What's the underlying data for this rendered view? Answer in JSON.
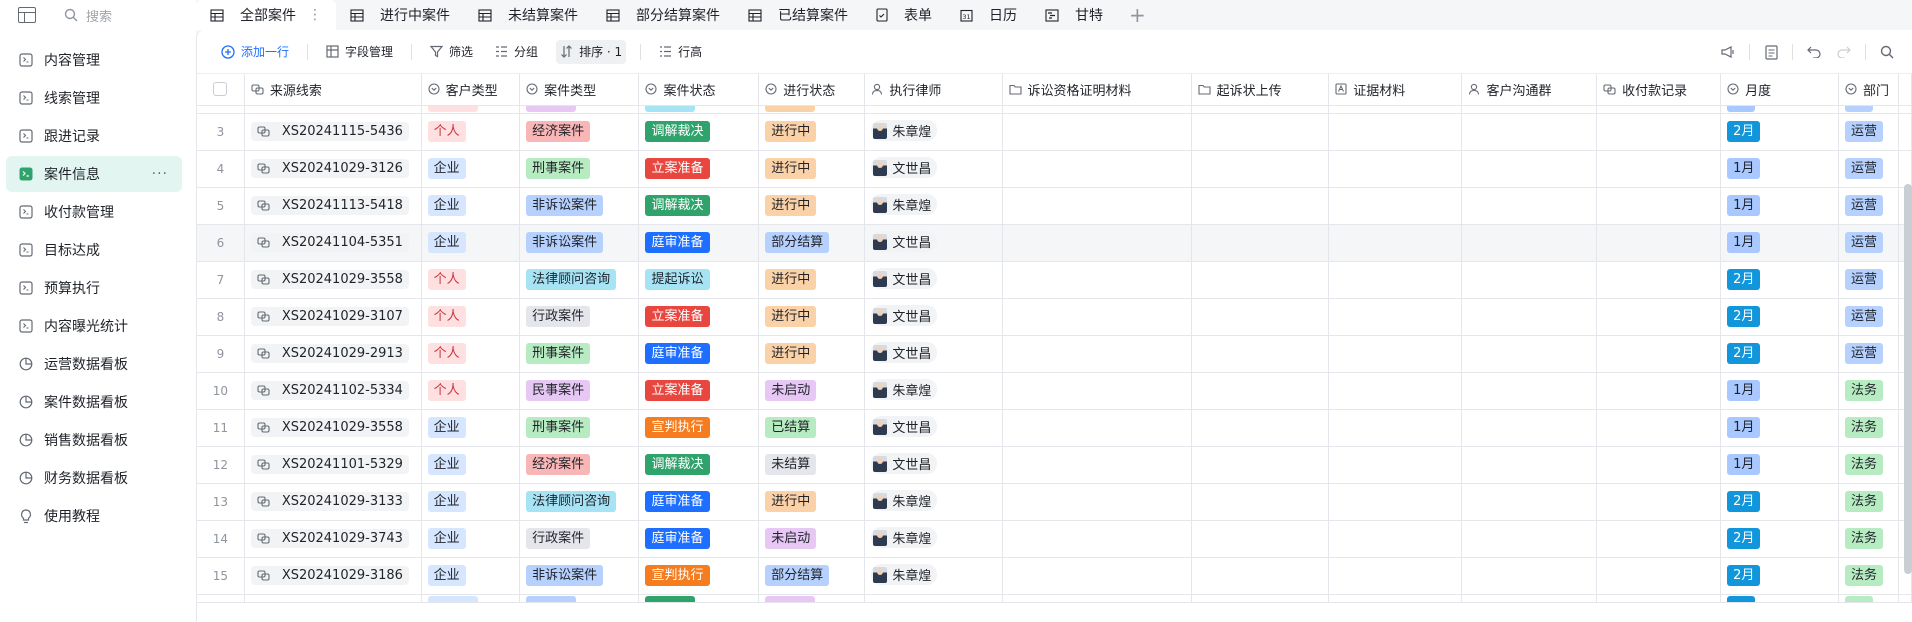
{
  "sidebar": {
    "search_placeholder": "搜索",
    "items": [
      {
        "label": "内容管理",
        "icon": "table-icon",
        "active": false
      },
      {
        "label": "线索管理",
        "icon": "table-icon",
        "active": false
      },
      {
        "label": "跟进记录",
        "icon": "table-icon",
        "active": false
      },
      {
        "label": "案件信息",
        "icon": "table-icon",
        "active": true,
        "more": "···"
      },
      {
        "label": "收付款管理",
        "icon": "table-icon",
        "active": false
      },
      {
        "label": "目标达成",
        "icon": "table-icon",
        "active": false
      },
      {
        "label": "预算执行",
        "icon": "table-icon",
        "active": false
      },
      {
        "label": "内容曝光统计",
        "icon": "table-icon",
        "active": false
      },
      {
        "label": "运营数据看板",
        "icon": "pie-chart-icon",
        "active": false
      },
      {
        "label": "案件数据看板",
        "icon": "pie-chart-icon",
        "active": false
      },
      {
        "label": "销售数据看板",
        "icon": "pie-chart-icon",
        "active": false
      },
      {
        "label": "财务数据看板",
        "icon": "pie-chart-icon",
        "active": false
      },
      {
        "label": "使用教程",
        "icon": "bulb-icon",
        "active": false
      }
    ]
  },
  "tabs": [
    {
      "label": "全部案件",
      "icon": "grid-icon",
      "active": true
    },
    {
      "label": "进行中案件",
      "icon": "grid-icon"
    },
    {
      "label": "未结算案件",
      "icon": "grid-icon"
    },
    {
      "label": "部分结算案件",
      "icon": "grid-icon"
    },
    {
      "label": "已结算案件",
      "icon": "grid-icon"
    },
    {
      "label": "表单",
      "icon": "form-icon"
    },
    {
      "label": "日历",
      "icon": "calendar-icon"
    },
    {
      "label": "甘特",
      "icon": "gantt-icon"
    }
  ],
  "tab_more": "⋮",
  "tab_add": "+",
  "toolbar": {
    "add_row": "添加一行",
    "fields": "字段管理",
    "filter": "筛选",
    "group": "分组",
    "sort": "排序 · 1",
    "row_height": "行高"
  },
  "columns": [
    "来源线索",
    "客户类型",
    "案件类型",
    "案件状态",
    "进行状态",
    "执行律师",
    "诉讼资格证明材料",
    "起诉状上传",
    "证据材料",
    "客户沟通群",
    "收付款记录",
    "月度",
    "部门"
  ],
  "colors": {
    "accent": "#1e6fff",
    "active_sidebar": "#e3f5f1",
    "个人": [
      "#ffe0e0",
      "#c9353f"
    ],
    "企业": [
      "#d6e6ff",
      "#1f2329"
    ],
    "经济案件": [
      "#f8b6b6",
      "#1f2329"
    ],
    "刑事案件": [
      "#b7ebc1",
      "#1f2329"
    ],
    "非诉讼案件": [
      "#b7d1ff",
      "#1f2329"
    ],
    "法律顾问咨询": [
      "#a6e3f5",
      "#1f2329"
    ],
    "行政案件": [
      "#e5e6eb",
      "#1f2329"
    ],
    "民事案件": [
      "#e7c8f5",
      "#1f2329"
    ],
    "调解裁决": [
      "#2fa36b",
      "#ffffff"
    ],
    "立案准备": [
      "#e8473f",
      "#ffffff"
    ],
    "庭审准备": [
      "#1e6fff",
      "#ffffff"
    ],
    "提起诉讼": [
      "#a6e3f5",
      "#1f2329"
    ],
    "宣判执行": [
      "#f57c1f",
      "#ffffff"
    ],
    "进行中": [
      "#fbd2a8",
      "#1f2329"
    ],
    "部分结算": [
      "#b7d1ff",
      "#1f2329"
    ],
    "未启动": [
      "#e7c8f5",
      "#1f2329"
    ],
    "已结算": [
      "#b7ebc1",
      "#1f2329"
    ],
    "未结算": [
      "#e5e6eb",
      "#1f2329"
    ],
    "2月": [
      "#1296db",
      "#ffffff"
    ],
    "1月": [
      "#a9c8ff",
      "#1f2329"
    ],
    "运营": [
      "#b7d1ff",
      "#1f2329"
    ],
    "法务": [
      "#b7ebc1",
      "#1f2329"
    ]
  },
  "rows": [
    {
      "n": "3",
      "lead": "XS20241115-5436",
      "ctype": "个人",
      "case": "经济案件",
      "status": "调解裁决",
      "prog": "进行中",
      "lawyer": "朱章煌",
      "month": "2月",
      "dept": "运营"
    },
    {
      "n": "4",
      "lead": "XS20241029-3126",
      "ctype": "企业",
      "case": "刑事案件",
      "status": "立案准备",
      "prog": "进行中",
      "lawyer": "文世昌",
      "month": "1月",
      "dept": "运营"
    },
    {
      "n": "5",
      "lead": "XS20241113-5418",
      "ctype": "企业",
      "case": "非诉讼案件",
      "status": "调解裁决",
      "prog": "进行中",
      "lawyer": "朱章煌",
      "month": "1月",
      "dept": "运营"
    },
    {
      "n": "6",
      "lead": "XS20241104-5351",
      "ctype": "企业",
      "case": "非诉讼案件",
      "status": "庭审准备",
      "prog": "部分结算",
      "lawyer": "文世昌",
      "month": "1月",
      "dept": "运营",
      "hover": true
    },
    {
      "n": "7",
      "lead": "XS20241029-3558",
      "ctype": "个人",
      "case": "法律顾问咨询",
      "status": "提起诉讼",
      "prog": "进行中",
      "lawyer": "文世昌",
      "month": "2月",
      "dept": "运营"
    },
    {
      "n": "8",
      "lead": "XS20241029-3107",
      "ctype": "个人",
      "case": "行政案件",
      "status": "立案准备",
      "prog": "进行中",
      "lawyer": "文世昌",
      "month": "2月",
      "dept": "运营"
    },
    {
      "n": "9",
      "lead": "XS20241029-2913",
      "ctype": "个人",
      "case": "刑事案件",
      "status": "庭审准备",
      "prog": "进行中",
      "lawyer": "文世昌",
      "month": "2月",
      "dept": "运营"
    },
    {
      "n": "10",
      "lead": "XS20241102-5334",
      "ctype": "个人",
      "case": "民事案件",
      "status": "立案准备",
      "prog": "未启动",
      "lawyer": "朱章煌",
      "month": "1月",
      "dept": "法务"
    },
    {
      "n": "11",
      "lead": "XS20241029-3558",
      "ctype": "企业",
      "case": "刑事案件",
      "status": "宣判执行",
      "prog": "已结算",
      "lawyer": "文世昌",
      "month": "1月",
      "dept": "法务"
    },
    {
      "n": "12",
      "lead": "XS20241101-5329",
      "ctype": "企业",
      "case": "经济案件",
      "status": "调解裁决",
      "prog": "未结算",
      "lawyer": "文世昌",
      "month": "1月",
      "dept": "法务"
    },
    {
      "n": "13",
      "lead": "XS20241029-3133",
      "ctype": "企业",
      "case": "法律顾问咨询",
      "status": "庭审准备",
      "prog": "进行中",
      "lawyer": "朱章煌",
      "month": "2月",
      "dept": "法务"
    },
    {
      "n": "14",
      "lead": "XS20241029-3743",
      "ctype": "企业",
      "case": "行政案件",
      "status": "庭审准备",
      "prog": "未启动",
      "lawyer": "朱章煌",
      "month": "2月",
      "dept": "法务"
    },
    {
      "n": "15",
      "lead": "XS20241029-3186",
      "ctype": "企业",
      "case": "非诉讼案件",
      "status": "宣判执行",
      "prog": "部分结算",
      "lawyer": "朱章煌",
      "month": "2月",
      "dept": "法务"
    }
  ]
}
